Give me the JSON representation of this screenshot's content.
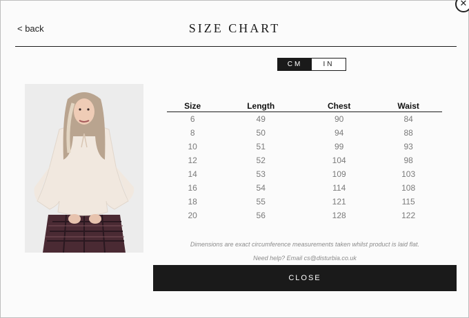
{
  "header": {
    "back_label": "< back",
    "title": "SIZE CHART",
    "close_glyph": "✕"
  },
  "unit_toggle": {
    "options": [
      "CM",
      "IN"
    ],
    "selected": "CM"
  },
  "table": {
    "columns": [
      "Size",
      "Length",
      "Chest",
      "Waist"
    ],
    "rows": [
      [
        "6",
        "49",
        "90",
        "84"
      ],
      [
        "8",
        "50",
        "94",
        "88"
      ],
      [
        "10",
        "51",
        "99",
        "93"
      ],
      [
        "12",
        "52",
        "104",
        "98"
      ],
      [
        "14",
        "53",
        "109",
        "103"
      ],
      [
        "16",
        "54",
        "114",
        "108"
      ],
      [
        "18",
        "55",
        "121",
        "115"
      ],
      [
        "20",
        "56",
        "128",
        "122"
      ]
    ]
  },
  "note": "Dimensions are exact circumference measurements taken whilst product is laid flat.",
  "help": "Need help? Email cs@disturbia.co.uk",
  "close_label": "CLOSE",
  "colors": {
    "accent": "#1a1a1a",
    "background": "#fbfbfb"
  }
}
